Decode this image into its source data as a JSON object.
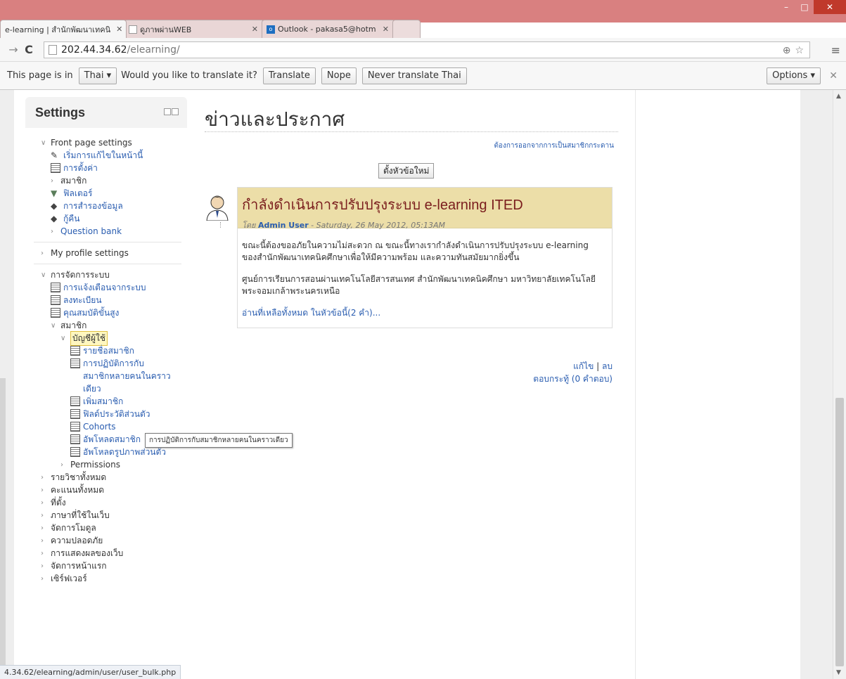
{
  "window": {
    "minimize": "–",
    "maximize": "□",
    "close": "✕"
  },
  "tabs": [
    {
      "title": "e-learning | สำนักพัฒนาเทคนิ",
      "close": "✕"
    },
    {
      "title": "ดูภาพผ่านWEB",
      "close": "✕"
    },
    {
      "title": "Outlook - pakasa5@hotm",
      "close": "✕"
    }
  ],
  "address": {
    "host": "202.44.34.62",
    "path": "/elearning/"
  },
  "translate_bar": {
    "prompt_start": "This page is in",
    "language": "Thai",
    "prompt_end": "Would you like to translate it?",
    "translate": "Translate",
    "nope": "Nope",
    "never": "Never translate Thai",
    "options": "Options",
    "close": "✕"
  },
  "settings": {
    "title": "Settings",
    "front_page": {
      "label": "Front page settings",
      "items": [
        {
          "label": "เริ่มการแก้ไขในหน้านี้"
        },
        {
          "label": "การตั้งค่า"
        },
        {
          "label": "สมาชิก"
        },
        {
          "label": "ฟิลเตอร์"
        },
        {
          "label": "การสำรองข้อมูล"
        },
        {
          "label": "กู้คืน"
        },
        {
          "label": "Question bank"
        }
      ]
    },
    "profile": {
      "label": "My profile settings"
    },
    "admin": {
      "label": "การจัดการระบบ",
      "items": [
        {
          "label": "การแจ้งเตือนจากระบบ"
        },
        {
          "label": "ลงทะเบียน"
        },
        {
          "label": "คุณสมบัติขั้นสูง"
        }
      ],
      "users": {
        "label": "สมาชิก",
        "accounts": {
          "label": "บัญชีผู้ใช้",
          "items": [
            {
              "label": "รายชื่อสมาชิก"
            },
            {
              "label": "การปฏิบัติการกับ"
            },
            {
              "label": "สมาชิกหลายคนในคราว"
            },
            {
              "label": "เดียว"
            },
            {
              "label": "เพิ่มสมาชิก"
            },
            {
              "label": "ฟิลด์ประวัติส่วนตัว"
            },
            {
              "label": "Cohorts"
            },
            {
              "label": "อัพโหลดสมาชิก"
            },
            {
              "label": "อัพโหลดรูปภาพส่วนตัว"
            }
          ]
        },
        "permissions": "Permissions"
      },
      "more": [
        {
          "label": "รายวิชาทั้งหมด"
        },
        {
          "label": "คะแนนทั้งหมด"
        },
        {
          "label": "ที่ตั้ง"
        },
        {
          "label": "ภาษาที่ใช้ในเว็บ"
        },
        {
          "label": "จัดการโมดูล"
        },
        {
          "label": "ความปลอดภัย"
        },
        {
          "label": "การแสดงผลของเว็บ"
        },
        {
          "label": "จัดการหน้าแรก"
        },
        {
          "label": "เซิร์ฟเวอร์"
        }
      ]
    }
  },
  "tooltip": "การปฏิบัติการกับสมาชิกหลายคนในคราวเดียว",
  "forum": {
    "title": "ข่าวและประกาศ",
    "unsubscribe": "ต้องการออกจากการเป็นสมาชิกกระดาน",
    "new_topic": "ตั้งหัวข้อใหม่",
    "post": {
      "subject": "กำลังดำเนินการปรับปรุงระบบ e-learning ITED",
      "by": "โดย",
      "author": "Admin User",
      "date": "- Saturday, 26 May 2012, 05:13AM",
      "body1": "ขณะนี้ต้องขออภัยในความไม่สะดวก ณ ขณะนี้ทางเรากำลังดำเนินการปรับปรุงระบบ e-learning ของสำนักพัฒนาเทคนิคศึกษาเพื่อให้มีความพร้อม และความทันสมัยมากยิ่งขึ้น",
      "body2": "ศูนย์การเรียนการสอนผ่านเทคโนโลยีสารสนเทศ สำนักพัฒนาเทคนิคศึกษา มหาวิทยาลัยเทคโนโลยีพระจอมเกล้าพระนครเหนือ",
      "read_more": "อ่านที่เหลือทั้งหมด ในหัวข้อนี้(2 คำ)...",
      "edit": "แก้ไข",
      "delete": "ลบ",
      "discuss": "ตอบกระทู้ (0 คำตอบ)"
    }
  },
  "status_url": "4.34.62/elearning/admin/user/user_bulk.php"
}
